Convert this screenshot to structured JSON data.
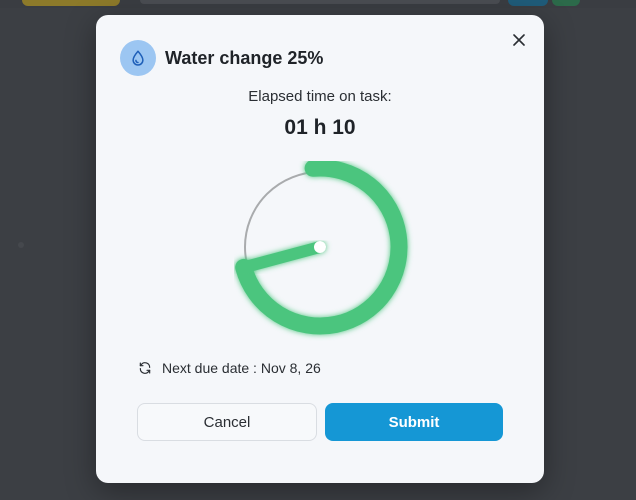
{
  "dialog": {
    "title": "Water change 25%",
    "icon": "water-drop-icon",
    "close_icon": "close-icon",
    "elapsed_label": "Elapsed time on task:",
    "elapsed_value": "01 h 10",
    "dial": {
      "elapsed_fraction": 0.194,
      "progress_color": "#4cc57e",
      "track_color": "#a9abad"
    },
    "due_icon": "refresh-icon",
    "due_text": "Next due date : Nov 8, 26",
    "cancel_label": "Cancel",
    "submit_label": "Submit"
  },
  "colors": {
    "accent": "#1597d5",
    "badge": "#9cc6f2",
    "progress": "#4cc57e"
  }
}
